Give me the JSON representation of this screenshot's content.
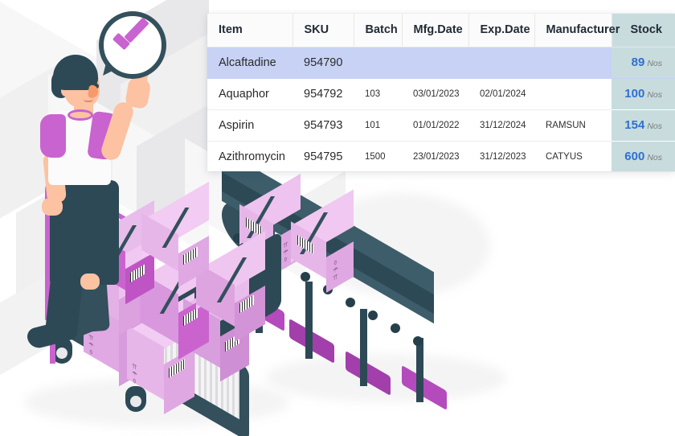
{
  "table": {
    "columns": [
      {
        "key": "item",
        "label": "Item"
      },
      {
        "key": "sku",
        "label": "SKU"
      },
      {
        "key": "batch",
        "label": "Batch"
      },
      {
        "key": "mfg_date",
        "label": "Mfg.Date"
      },
      {
        "key": "exp_date",
        "label": "Exp.Date"
      },
      {
        "key": "manufacturer",
        "label": "Manufacturer"
      },
      {
        "key": "stock",
        "label": "Stock"
      }
    ],
    "rows": [
      {
        "item": "Alcaftadine",
        "sku": "954790",
        "batch": "",
        "mfg_date": "",
        "exp_date": "",
        "manufacturer": "",
        "stock": "89",
        "unit": "Nos",
        "selected": true
      },
      {
        "item": "Aquaphor",
        "sku": "954792",
        "batch": "103",
        "mfg_date": "03/01/2023",
        "exp_date": "02/01/2024",
        "manufacturer": "",
        "stock": "100",
        "unit": "Nos",
        "selected": false
      },
      {
        "item": "Aspirin",
        "sku": "954793",
        "batch": "101",
        "mfg_date": "01/01/2022",
        "exp_date": "31/12/2024",
        "manufacturer": "RAMSUN",
        "stock": "154",
        "unit": "Nos",
        "selected": false
      },
      {
        "item": "Azithromycin",
        "sku": "954795",
        "batch": "1500",
        "mfg_date": "23/01/2023",
        "exp_date": "31/12/2023",
        "manufacturer": "CATYUS",
        "stock": "600",
        "unit": "Nos",
        "selected": false
      }
    ]
  },
  "illustration": {
    "scene_label": "warehouse-worker-with-cart-and-conveyor",
    "approval_icon": "check-mark-icon",
    "colors": {
      "accent_purple": "#c963d0",
      "box_pink": "#e7b6e9",
      "box_magenta": "#cb63cf",
      "dark_teal": "#2d4955",
      "skin": "#fcc2a2",
      "shelf_gray": "#f0f0f1"
    }
  },
  "theme": {
    "stock_header_bg": "#c8dcde",
    "selected_row_bg": "#c7d2f5",
    "stock_number_color": "#2f6fd0",
    "page_bg": "#ffffff"
  }
}
